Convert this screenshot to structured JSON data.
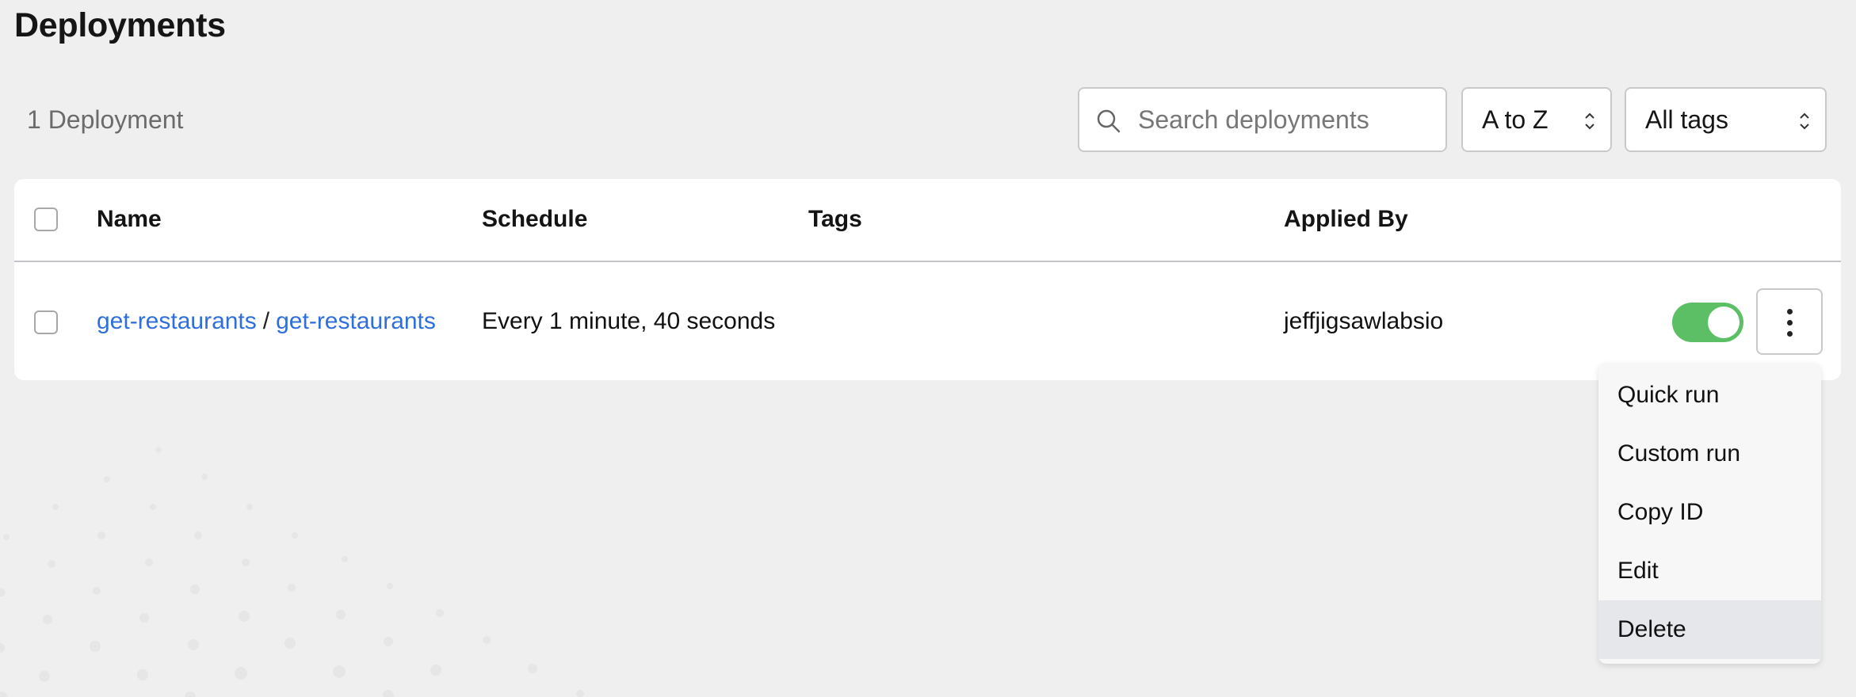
{
  "page": {
    "title": "Deployments"
  },
  "toolbar": {
    "count_label": "1 Deployment",
    "search_placeholder": "Search deployments",
    "sort_value": "A to Z",
    "tags_value": "All tags"
  },
  "table": {
    "columns": [
      "Name",
      "Schedule",
      "Tags",
      "Applied By"
    ],
    "rows": [
      {
        "flow_name": "get-restaurants",
        "separator": "/",
        "deployment_name": "get-restaurants",
        "schedule": "Every 1 minute, 40 seconds",
        "tags": "",
        "applied_by": "jeffjigsawlabsio",
        "enabled": true
      }
    ]
  },
  "menu": {
    "items": [
      "Quick run",
      "Custom run",
      "Copy ID",
      "Edit",
      "Delete"
    ],
    "highlighted": "Delete"
  },
  "icons": {
    "search": "search-icon",
    "sort_chevron": "chevron-up-down-icon",
    "tags_chevron": "chevron-up-down-icon",
    "more": "kebab-menu-icon"
  },
  "colors": {
    "link": "#2f6fdb",
    "toggle_on": "#5cbf65",
    "background": "#efefef"
  }
}
